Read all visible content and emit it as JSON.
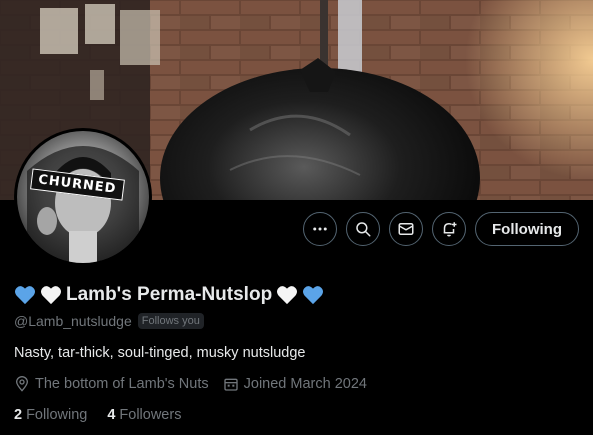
{
  "banner": {
    "description_icon": "trash-bag-banner"
  },
  "avatar": {
    "overlay_text": "CHURNED"
  },
  "actions": {
    "more_icon": "more-icon",
    "search_icon": "search-icon",
    "message_icon": "envelope-icon",
    "notify_icon": "bell-plus-icon",
    "follow_label": "Following"
  },
  "profile": {
    "display_name": "Lamb's Perma-Nutslop",
    "handle": "@Lamb_nutsludge",
    "follows_you": "Follows you",
    "bio": "Nasty, tar-thick, soul-tinged, musky nutsludge",
    "location": "The bottom of Lamb's Nuts",
    "joined": "Joined March 2024"
  },
  "stats": {
    "following_count": "2",
    "following_label": "Following",
    "followers_count": "4",
    "followers_label": "Followers"
  },
  "colors": {
    "accent_blue_heart": "#5ba4e8",
    "white_heart": "#f5f5f5",
    "muted": "#71767b",
    "text": "#e7e9ea",
    "border": "#536471"
  }
}
